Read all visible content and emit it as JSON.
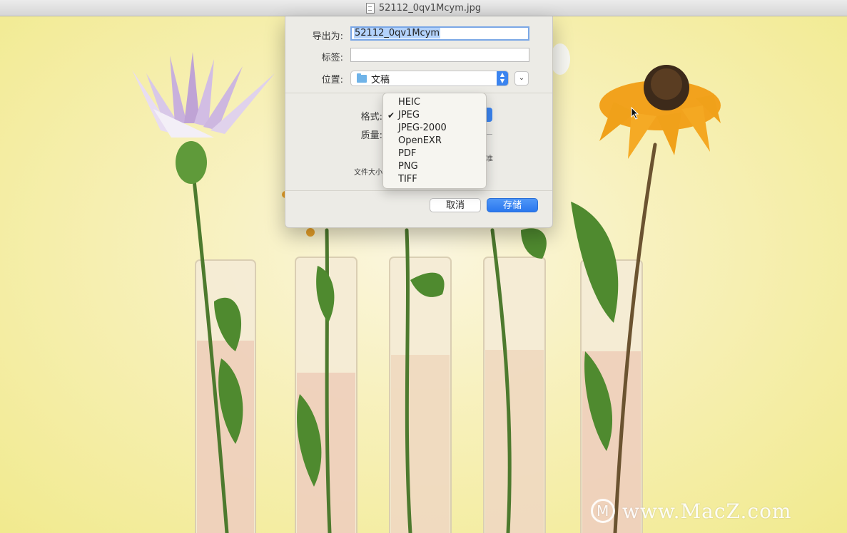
{
  "window": {
    "title": "52112_0qv1Mcym.jpg"
  },
  "dialog": {
    "export_as_label": "导出为:",
    "export_as_value": "52112_0qv1Mcym",
    "tags_label": "标签:",
    "tags_value": "",
    "location_label": "位置:",
    "location_value": "文稿",
    "format_label": "格式:",
    "quality_label": "质量:",
    "file_size_label": "文件大小:",
    "cancel_label": "取消",
    "save_label": "存储"
  },
  "format_menu": {
    "selected": "JPEG",
    "items": [
      "HEIC",
      "JPEG",
      "JPEG-2000",
      "OpenEXR",
      "PDF",
      "PNG",
      "TIFF"
    ]
  },
  "watermark": {
    "text": "www.MacZ.com"
  },
  "icons": [
    "document-icon",
    "folder-icon",
    "stepper-icon",
    "chevron-down-icon",
    "checkmark-icon",
    "macz-logo-icon",
    "cursor-icon"
  ],
  "colors": {
    "accent": "#2a77ee",
    "menu_bg": "#f6f5f0",
    "dialog_bg": "#ecebe6"
  }
}
